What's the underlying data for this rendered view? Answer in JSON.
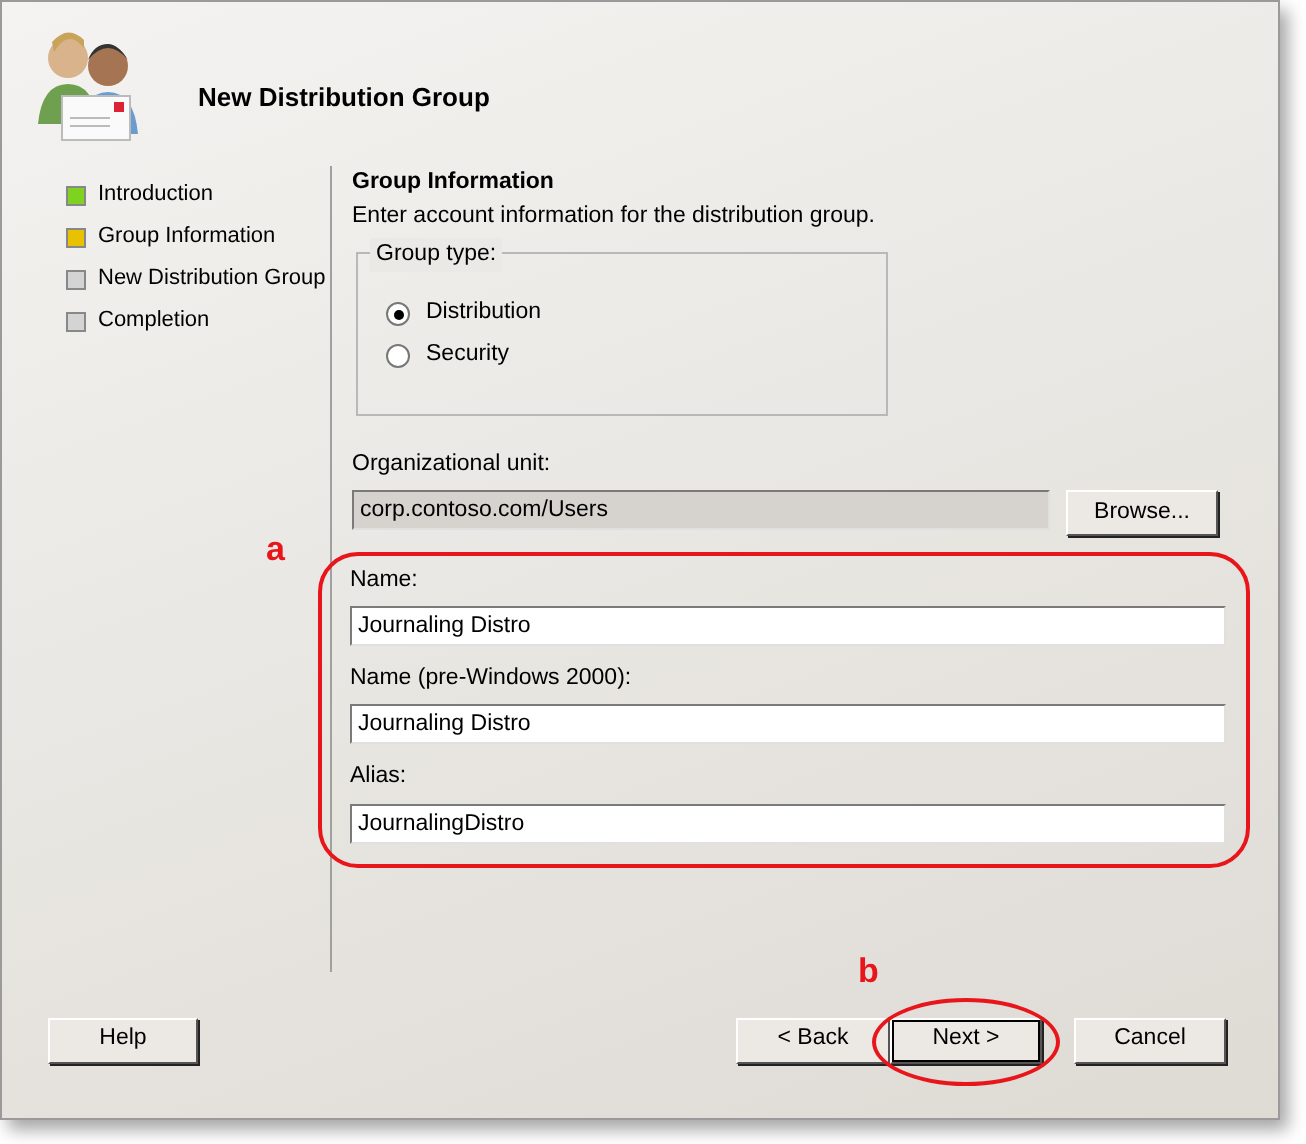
{
  "window": {
    "title": "New Distribution Group"
  },
  "steps": [
    {
      "label": "Introduction",
      "color": "#7ed321"
    },
    {
      "label": "Group Information",
      "color": "#e8c100"
    },
    {
      "label": "New Distribution Group",
      "color": "#d4d4d4"
    },
    {
      "label": "Completion",
      "color": "#d4d4d4"
    }
  ],
  "page": {
    "heading": "Group Information",
    "description": "Enter account information for the distribution group.",
    "group_type": {
      "legend": "Group type:",
      "options": [
        {
          "label": "Distribution",
          "selected": true
        },
        {
          "label": "Security",
          "selected": false
        }
      ]
    },
    "org_unit": {
      "label": "Organizational unit:",
      "value": "corp.contoso.com/Users",
      "button": "Browse..."
    },
    "fields": [
      {
        "label": "Name:",
        "value": "Journaling Distro"
      },
      {
        "label": "Name (pre-Windows 2000):",
        "value": "Journaling Distro"
      },
      {
        "label": "Alias:",
        "value": "JournalingDistro"
      }
    ]
  },
  "annotations": [
    {
      "text": "a"
    },
    {
      "text": "b"
    }
  ],
  "buttons": {
    "help": "Help",
    "back": "< Back",
    "next": "Next >",
    "cancel": "Cancel"
  }
}
